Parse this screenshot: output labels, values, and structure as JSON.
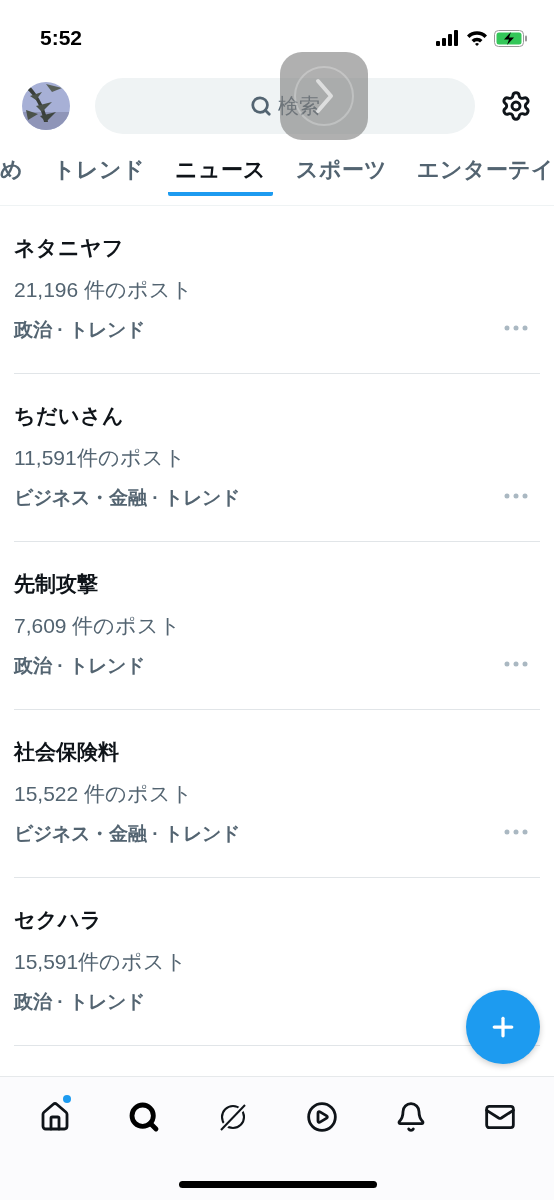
{
  "status_bar": {
    "time": "5:52"
  },
  "header": {
    "search": {
      "placeholder": "検索"
    }
  },
  "tabs": [
    {
      "label": "め",
      "selected": false
    },
    {
      "label": "トレンド",
      "selected": false
    },
    {
      "label": "ニュース",
      "selected": true
    },
    {
      "label": "スポーツ",
      "selected": false
    },
    {
      "label": "エンターテイ",
      "selected": false
    }
  ],
  "trends": [
    {
      "title": "ネタニヤフ",
      "count": "21,196 件のポスト",
      "category": "政治 · トレンド"
    },
    {
      "title": "ちだいさん",
      "count": "11,591件のポスト",
      "category": "ビジネス・金融 · トレンド"
    },
    {
      "title": "先制攻撃",
      "count": "7,609 件のポスト",
      "category": "政治 · トレンド"
    },
    {
      "title": "社会保険料",
      "count": "15,522 件のポスト",
      "category": "ビジネス・金融 · トレンド"
    },
    {
      "title": "セクハラ",
      "count": "15,591件のポスト",
      "category": "政治 · トレンド"
    }
  ],
  "nav": [
    {
      "kind": "home",
      "selected": false,
      "dot": true
    },
    {
      "kind": "search",
      "selected": true,
      "dot": false
    },
    {
      "kind": "grok",
      "selected": false,
      "dot": false
    },
    {
      "kind": "video",
      "selected": false,
      "dot": false
    },
    {
      "kind": "notifications",
      "selected": false,
      "dot": false
    },
    {
      "kind": "messages",
      "selected": false,
      "dot": false
    }
  ]
}
